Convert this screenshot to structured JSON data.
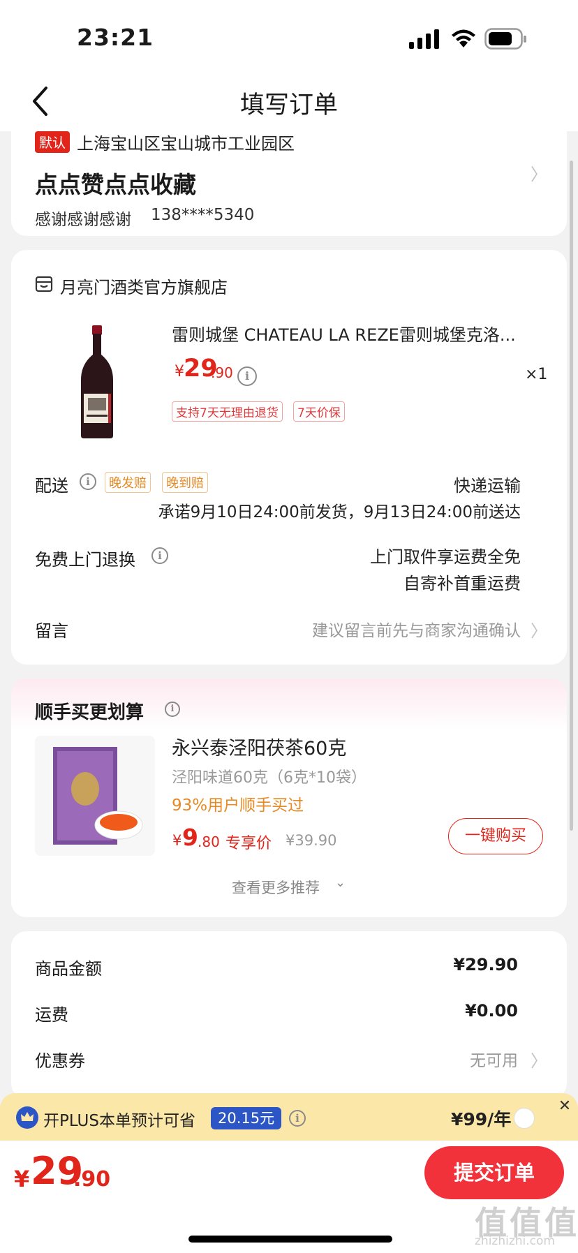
{
  "status_bar": {
    "time": "23:21"
  },
  "nav": {
    "title": "填写订单"
  },
  "address": {
    "default_tag": "默认",
    "region": "上海宝山区宝山城市工业园区",
    "detail": "点点赞点点收藏",
    "name": "感谢感谢感谢",
    "phone": "138****5340"
  },
  "shop": {
    "name": "月亮门酒类官方旗舰店"
  },
  "product": {
    "title": "雷则城堡 CHATEAU LA REZE雷则城堡克洛...",
    "currency": "¥",
    "price_int": "29",
    "price_dec": ".90",
    "qty": "×1",
    "tags": [
      "支持7天无理由退货",
      "7天价保"
    ]
  },
  "delivery": {
    "label": "配送",
    "tags": [
      "晚发赔",
      "晚到赔"
    ],
    "method": "快递运输",
    "promise": "承诺9月10日24:00前发货，9月13日24:00前送达"
  },
  "return_service": {
    "label": "免费上门退换",
    "line1": "上门取件享运费全免",
    "line2": "自寄补首重运费"
  },
  "message": {
    "label": "留言",
    "placeholder": "建议留言前先与商家沟通确认"
  },
  "addon": {
    "title": "顺手买更划算",
    "name": "永兴泰泾阳茯茶60克",
    "spec": "泾阳味道60克（6克*10袋）",
    "social": "93%用户顺手买过",
    "currency": "¥",
    "price_int": "9",
    "price_dec": ".80",
    "price_label": "专享价",
    "orig_price": "¥39.90",
    "buy_button": "一键购买",
    "more": "查看更多推荐"
  },
  "summary": {
    "goods_label": "商品金额",
    "goods_value": "¥29.90",
    "shipping_label": "运费",
    "shipping_value": "¥0.00",
    "coupon_label": "优惠券",
    "coupon_value": "无可用"
  },
  "plus_banner": {
    "text": "开PLUS本单预计可省",
    "saving": "20.15元",
    "price": "¥99/年"
  },
  "footer": {
    "currency": "¥",
    "total_int": "29",
    "total_dec": ".90",
    "submit": "提交订单"
  },
  "watermark": "值 值 值",
  "watermark_url": "zhizhizhi.com",
  "colors": {
    "accent": "#e1251b",
    "plus_bg": "#fbe7a8",
    "saving_bg": "#2c56c6"
  }
}
